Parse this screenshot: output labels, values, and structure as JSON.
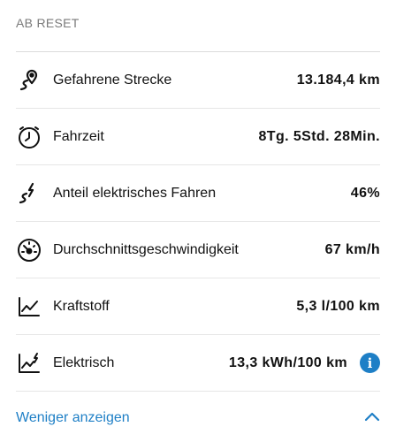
{
  "section": {
    "header": "AB RESET"
  },
  "rows": [
    {
      "icon": "route-pin-icon",
      "label": "Gefahrene Strecke",
      "value": "13.184,4 km"
    },
    {
      "icon": "clock-icon",
      "label": "Fahrzeit",
      "value": "8Tg. 5Std. 28Min."
    },
    {
      "icon": "electric-route-icon",
      "label": "Anteil elektrisches Fahren",
      "value": "46%"
    },
    {
      "icon": "speedometer-icon",
      "label": "Durchschnittsgeschwindigkeit",
      "value": "67 km/h"
    },
    {
      "icon": "fuel-consumption-chart-icon",
      "label": "Kraftstoff",
      "value": "5,3 l/100 km"
    },
    {
      "icon": "electric-consumption-chart-icon",
      "label": "Elektrisch",
      "value": "13,3 kWh/100 km",
      "info": "i"
    }
  ],
  "footer": {
    "toggle_label": "Weniger anzeigen",
    "chevron_icon": "chevron-up-icon"
  },
  "colors": {
    "accent": "#1e7fc6",
    "header_text": "#7a7a7a",
    "divider": "#e6e6e6"
  }
}
